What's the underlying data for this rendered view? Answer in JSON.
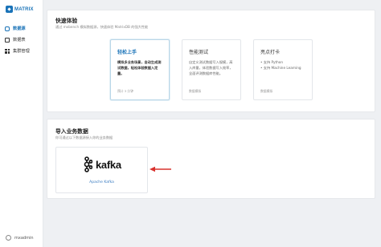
{
  "brand": {
    "name": "MATRIX"
  },
  "sidebar": {
    "items": [
      {
        "label": "数据源",
        "icon": "database-icon",
        "active": true
      },
      {
        "label": "数据表",
        "icon": "table-icon",
        "active": false
      },
      {
        "label": "集群管理",
        "icon": "cluster-icon",
        "active": false
      }
    ],
    "user": "mxadmin"
  },
  "quickstart": {
    "title": "快速体验",
    "subtitle": "通过 mxbench 模拟数据源，快速体验 MatrixDB 的强大性能",
    "cards": [
      {
        "title": "轻松上手",
        "desc": "模拟多业务场景，自动生成测试数据，轻松体验数据入定量。",
        "link": "预计 3 分钟"
      },
      {
        "title": "性能测试",
        "desc": "自定义测试数据写入规模，高入库量，体验数据写入效率，全面评测数据库性能。",
        "link": "数据模拟"
      },
      {
        "title": "亮点打卡",
        "desc": "• 支持 Python\n• 支持 Machine Learning",
        "link": "数据模拟"
      }
    ]
  },
  "import": {
    "title": "导入业务数据",
    "subtitle": "你可通过以下数据源接入你的业务数据",
    "source": {
      "logo_text": "kafka",
      "name": "Apache Kafka"
    }
  },
  "colors": {
    "accent": "#1a73b8",
    "arrow": "#d9322e"
  }
}
